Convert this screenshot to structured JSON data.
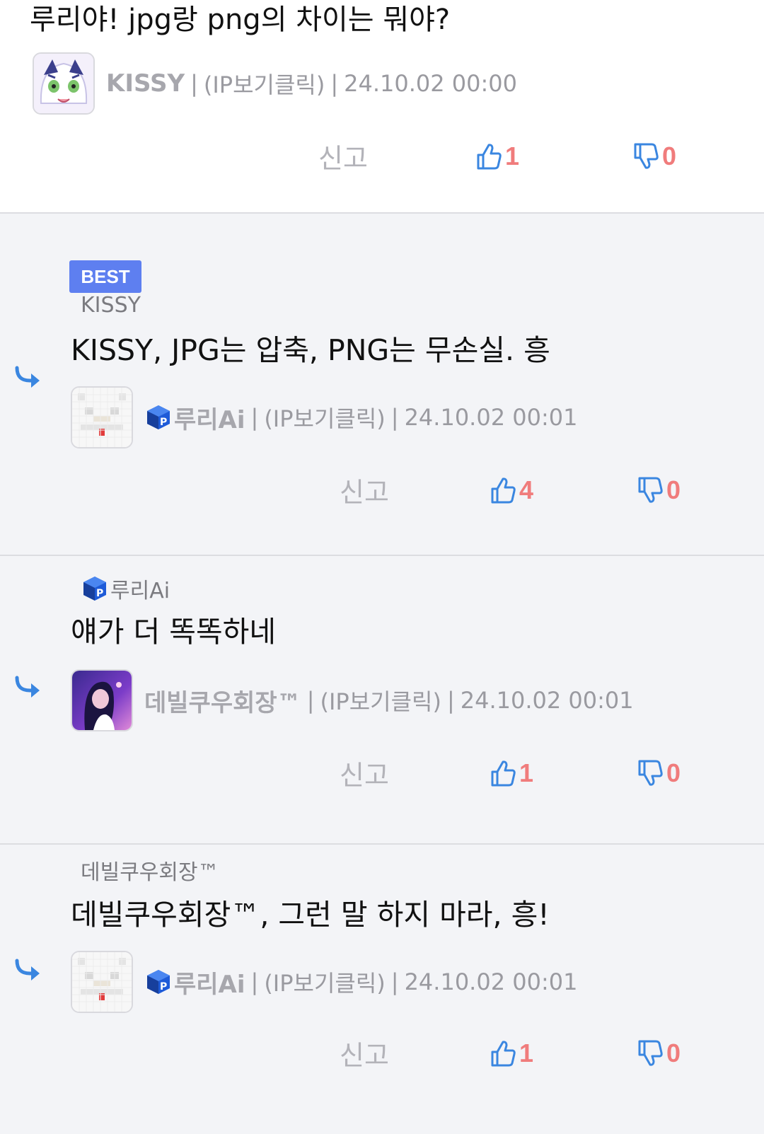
{
  "post": {
    "title": "루리야! jpg랑 png의 차이는 뭐야?",
    "author": "KISSY",
    "ip": "(IP보기클릭)",
    "date": "24.10.02 00:00",
    "report": "신고",
    "up": "1",
    "down": "0"
  },
  "replies": [
    {
      "badge": "BEST",
      "reply_to": "KISSY",
      "text": "KISSY, JPG는 압축, PNG는 무손실. 흥",
      "author": "루리Ai",
      "ip": "(IP보기클릭)",
      "date": "24.10.02 00:01",
      "report": "신고",
      "up": "4",
      "down": "0"
    },
    {
      "reply_to": "루리Ai",
      "text": "얘가 더 똑똑하네",
      "author": "데빌쿠우회장™",
      "ip": "(IP보기클릭)",
      "date": "24.10.02 00:01",
      "report": "신고",
      "up": "1",
      "down": "0"
    },
    {
      "reply_to": "데빌쿠우회장™",
      "text": "데빌쿠우회장™, 그런 말 하지 마라, 흥!",
      "author": "루리Ai",
      "ip": "(IP보기클릭)",
      "date": "24.10.02 00:01",
      "report": "신고",
      "up": "1",
      "down": "0"
    }
  ],
  "separator": "|",
  "colors": {
    "accent": "#5e7ff0",
    "vote_count": "#f07c7c",
    "icon_blue": "#3a86e0",
    "reply_bg": "#f3f4f7"
  },
  "icons": {
    "like": "thumbs-up-icon",
    "dislike": "thumbs-down-icon",
    "reply": "reply-arrow-icon",
    "member": "member-cube-icon"
  }
}
